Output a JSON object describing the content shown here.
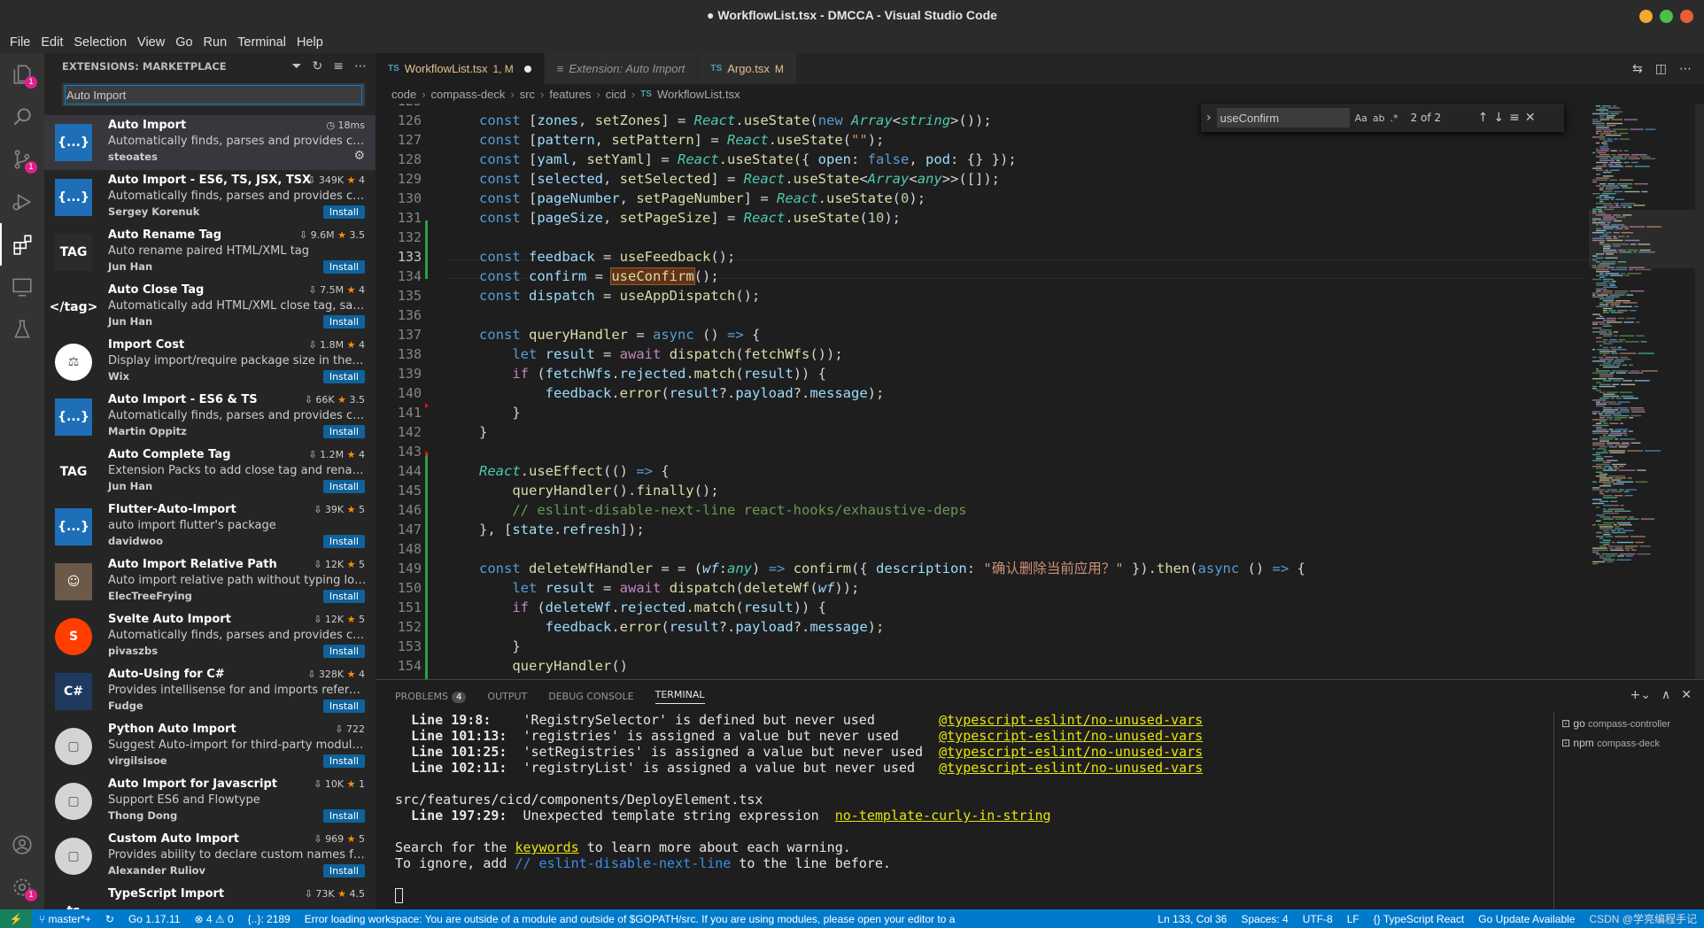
{
  "window": {
    "title": "● WorkflowList.tsx - DMCCA - Visual Studio Code",
    "dot_colors": [
      "#f4a731",
      "#4cbf4b",
      "#e95e36"
    ]
  },
  "menu": [
    "File",
    "Edit",
    "Selection",
    "View",
    "Go",
    "Run",
    "Terminal",
    "Help"
  ],
  "activity_badges": {
    "explorer": "1",
    "scm": "1",
    "settings": "1"
  },
  "sidebar": {
    "title": "EXTENSIONS: MARKETPLACE",
    "search_value": "Auto Import",
    "extensions": [
      {
        "name": "Auto Import",
        "desc": "Automatically finds, parses and provides code a...",
        "publisher": "steoates",
        "stats": "18ms",
        "rating": "",
        "action": "",
        "icon": "{...}",
        "icon_color": "#1e6fb8"
      },
      {
        "name": "Auto Import - ES6, TS, JSX, TSX",
        "desc": "Automatically finds, parses and provides code a...",
        "publisher": "Sergey Korenuk",
        "stats": "349K",
        "rating": "4",
        "action": "Install",
        "icon": "{...}",
        "icon_color": "#1e6fb8"
      },
      {
        "name": "Auto Rename Tag",
        "desc": "Auto rename paired HTML/XML tag",
        "publisher": "Jun Han",
        "stats": "9.6M",
        "rating": "3.5",
        "action": "Install",
        "icon": "TAG",
        "icon_color": "#2b2b2b"
      },
      {
        "name": "Auto Close Tag",
        "desc": "Automatically add HTML/XML close tag, same a...",
        "publisher": "Jun Han",
        "stats": "7.5M",
        "rating": "4",
        "action": "Install",
        "icon": "</tag>",
        "icon_color": "#252526"
      },
      {
        "name": "Import Cost",
        "desc": "Display import/require package size in the editor",
        "publisher": "Wix",
        "stats": "1.8M",
        "rating": "4",
        "action": "Install",
        "icon": "⚖",
        "icon_color": "#ffffff"
      },
      {
        "name": "Auto Import - ES6 & TS",
        "desc": "Automatically finds, parses and provides code a...",
        "publisher": "Martin Oppitz",
        "stats": "66K",
        "rating": "3.5",
        "action": "Install",
        "icon": "{...}",
        "icon_color": "#1e6fb8"
      },
      {
        "name": "Auto Complete Tag",
        "desc": "Extension Packs to add close tag and rename p...",
        "publisher": "Jun Han",
        "stats": "1.2M",
        "rating": "4",
        "action": "Install",
        "icon": "TAG",
        "icon_color": "#252526"
      },
      {
        "name": "Flutter-Auto-Import",
        "desc": "auto import flutter's package",
        "publisher": "davidwoo",
        "stats": "39K",
        "rating": "5",
        "action": "Install",
        "icon": "{...}",
        "icon_color": "#1e6fb8"
      },
      {
        "name": "Auto Import Relative Path",
        "desc": "Auto import relative path without typing long a...",
        "publisher": "ElecTreeFrying",
        "stats": "12K",
        "rating": "5",
        "action": "Install",
        "icon": "☺",
        "icon_color": "#6b5a48"
      },
      {
        "name": "Svelte Auto Import",
        "desc": "Automatically finds, parses and provides code a...",
        "publisher": "pivaszbs",
        "stats": "12K",
        "rating": "5",
        "action": "Install",
        "icon": "S",
        "icon_color": "#ff3e00"
      },
      {
        "name": "Auto-Using for C#",
        "desc": "Provides intellisense for and imports reference...",
        "publisher": "Fudge",
        "stats": "328K",
        "rating": "4",
        "action": "Install",
        "icon": "C#",
        "icon_color": "#1e3a5f"
      },
      {
        "name": "Python Auto Import",
        "desc": "Suggest Auto-import for third-party modules b...",
        "publisher": "virgilsisoe",
        "stats": "722",
        "rating": "",
        "action": "Install",
        "icon": "▢",
        "icon_color": "#d4d4d4"
      },
      {
        "name": "Auto Import for Javascript",
        "desc": "Support ES6 and Flowtype",
        "publisher": "Thong Dong",
        "stats": "10K",
        "rating": "1",
        "action": "Install",
        "icon": "▢",
        "icon_color": "#d4d4d4"
      },
      {
        "name": "Custom Auto Import",
        "desc": "Provides ability to declare custom names for pa...",
        "publisher": "Alexander Ruliov",
        "stats": "969",
        "rating": "5",
        "action": "Install",
        "icon": "▢",
        "icon_color": "#d4d4d4"
      },
      {
        "name": "TypeScript Import",
        "desc": "",
        "publisher": "",
        "stats": "73K",
        "rating": "4.5",
        "action": "",
        "icon": "ts",
        "icon_color": "#252526"
      }
    ]
  },
  "tabs": [
    {
      "label": "WorkflowList.tsx",
      "prefix": "TS",
      "suffix": "1, M",
      "active": true
    },
    {
      "label": "Extension: Auto Import",
      "prefix": "≡",
      "suffix": "",
      "active": false
    },
    {
      "label": "Argo.tsx",
      "prefix": "TS",
      "suffix": "M",
      "active": false
    }
  ],
  "breadcrumb": [
    "code",
    "compass-deck",
    "src",
    "features",
    "cicd",
    "WorkflowList.tsx"
  ],
  "find": {
    "query": "useConfirm",
    "count": "2 of 2",
    "opts": [
      "Aa",
      "ab",
      ".*"
    ]
  },
  "editor": {
    "current_line": "133",
    "line_numbers": [
      "125",
      "126",
      "127",
      "128",
      "129",
      "130",
      "131",
      "132",
      "133",
      "134",
      "135",
      "136",
      "137",
      "138",
      "139",
      "140",
      "141",
      "142",
      "143",
      "144",
      "145",
      "146",
      "147",
      "148",
      "149",
      "150",
      "151",
      "152",
      "153",
      "154"
    ]
  },
  "panel": {
    "tabs": [
      "PROBLEMS",
      "OUTPUT",
      "DEBUG CONSOLE",
      "TERMINAL"
    ],
    "problems_count": "4",
    "lint_lines": [
      {
        "loc": "Line 19:8:  ",
        "msg": "'RegistrySelector' is defined but never used      ",
        "rule": "@typescript-eslint/no-unused-vars"
      },
      {
        "loc": "Line 101:13:",
        "msg": "'registries' is assigned a value but never used   ",
        "rule": "@typescript-eslint/no-unused-vars"
      },
      {
        "loc": "Line 101:25:",
        "msg": "'setRegistries' is assigned a value but never used",
        "rule": "@typescript-eslint/no-unused-vars"
      },
      {
        "loc": "Line 102:11:",
        "msg": "'registryList' is assigned a value but never used ",
        "rule": "@typescript-eslint/no-unused-vars"
      }
    ],
    "file_line": "src/features/cicd/components/DeployElement.tsx",
    "tmpl_loc": "  Line 197:29:",
    "tmpl_msg": "  Unexpected template string expression  ",
    "tmpl_rule": "no-template-curly-in-string",
    "search_pre": "Search for the ",
    "search_link": "keywords",
    "search_post": " to learn more about each warning.",
    "ignore_pre": "To ignore, add ",
    "ignore_link": "// eslint-disable-next-line",
    "ignore_post": " to the line before.",
    "terminals": [
      {
        "shell": "go",
        "name": "compass-controller"
      },
      {
        "shell": "npm",
        "name": "compass-deck"
      }
    ]
  },
  "status": {
    "branch": "master*+",
    "go_version": "Go 1.17.11",
    "errors": "4",
    "warnings": "0",
    "braces": "{..}: 2189",
    "message": "Error loading workspace: You are outside of a module and outside of $GOPATH/src. If you are using modules, please open your editor to a",
    "position": "Ln 133, Col 36",
    "spaces": "Spaces: 4",
    "encoding": "UTF-8",
    "eol": "LF",
    "language": "TypeScript React",
    "update": "Go Update Available",
    "watermark": "CSDN @学亮编程手记"
  }
}
